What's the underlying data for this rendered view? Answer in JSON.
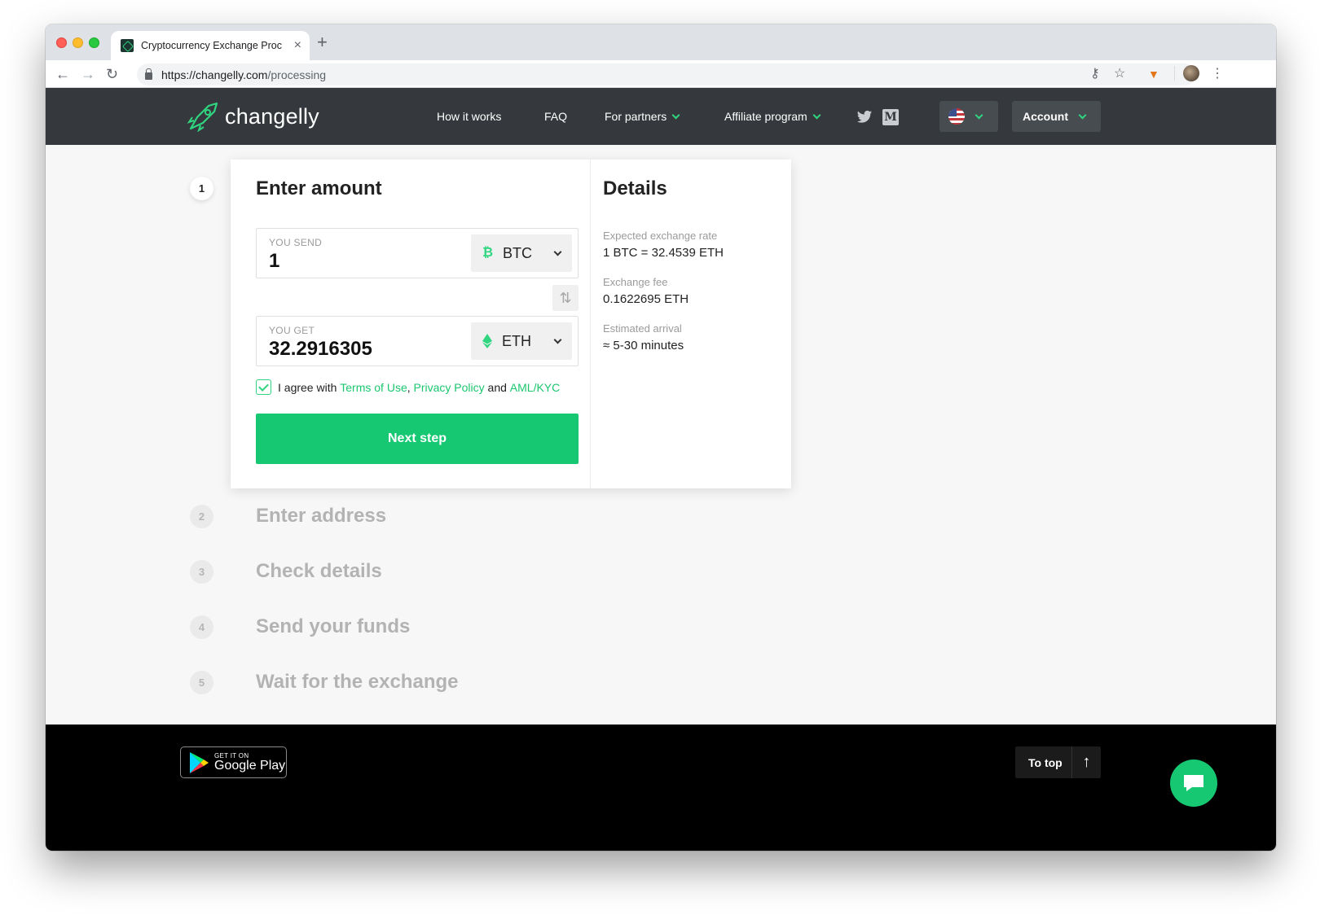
{
  "browser": {
    "tab_title": "Cryptocurrency Exchange Proc",
    "url_domain": "https://changelly.com",
    "url_path": "/processing"
  },
  "header": {
    "logo_text": "changelly",
    "nav": {
      "how_it_works": "How it works",
      "faq": "FAQ",
      "for_partners": "For partners",
      "affiliate": "Affiliate program"
    },
    "account_label": "Account"
  },
  "steps": {
    "s1": {
      "number": "1",
      "title": "Enter amount"
    },
    "s2": {
      "number": "2",
      "title": "Enter address"
    },
    "s3": {
      "number": "3",
      "title": "Check details"
    },
    "s4": {
      "number": "4",
      "title": "Send your funds"
    },
    "s5": {
      "number": "5",
      "title": "Wait for the exchange"
    }
  },
  "form": {
    "send": {
      "label": "YOU SEND",
      "value": "1",
      "currency": "BTC"
    },
    "get": {
      "label": "YOU GET",
      "value": "32.2916305",
      "currency": "ETH"
    },
    "agree": {
      "prefix": "I agree with",
      "terms": "Terms of Use",
      "comma": ",",
      "privacy": "Privacy Policy",
      "and": "and",
      "aml": "AML/KYC"
    },
    "next_label": "Next step"
  },
  "details": {
    "title": "Details",
    "rate_label": "Expected exchange rate",
    "rate_value": "1 BTC = 32.4539 ETH",
    "fee_label": "Exchange fee",
    "fee_value": "0.1622695 ETH",
    "arrival_label": "Estimated arrival",
    "arrival_value": "≈ 5-30 minutes"
  },
  "footer": {
    "gplay_small": "GET IT ON",
    "gplay_big": "Google Play",
    "to_top": "To top"
  },
  "colors": {
    "brand_green": "#16c872",
    "header_bg": "#35393d",
    "footer_bg": "#000000"
  }
}
